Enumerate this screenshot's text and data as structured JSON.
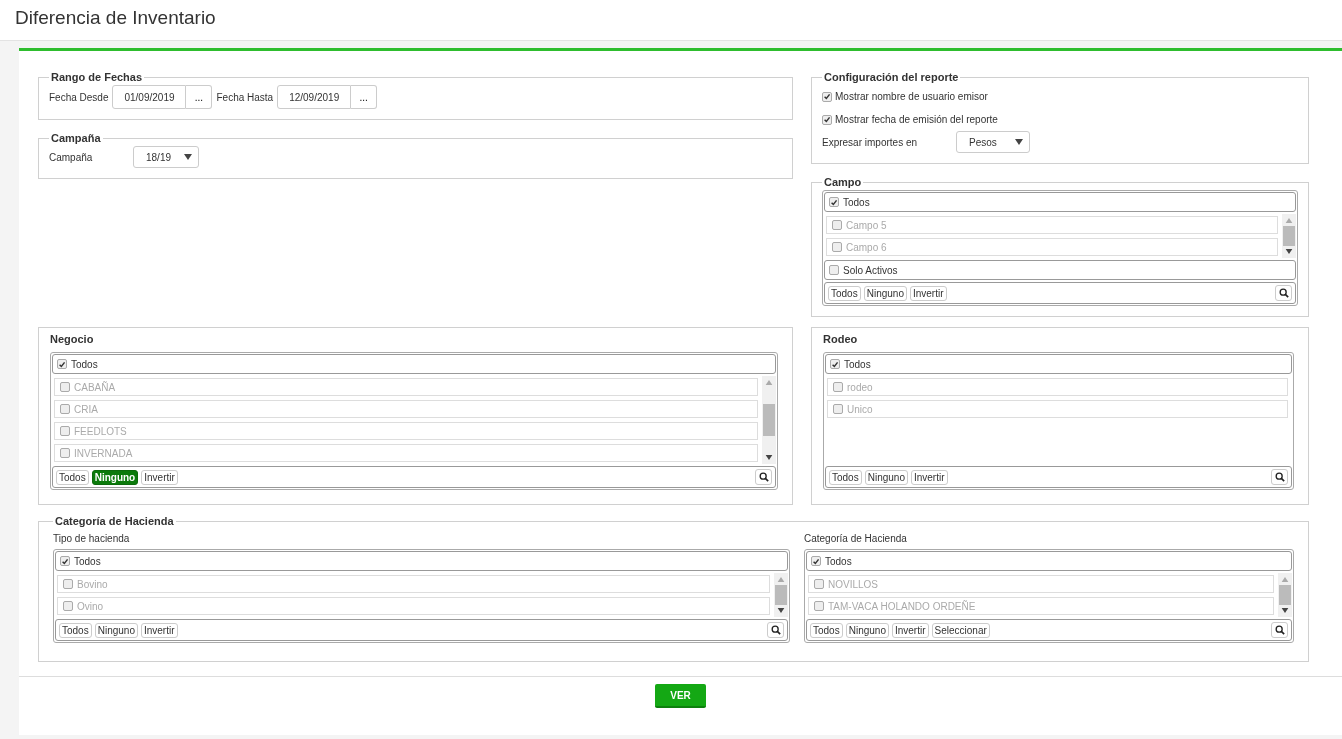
{
  "page": {
    "title": "Diferencia de Inventario"
  },
  "rango_de_fechas": {
    "legend": "Rango de Fechas",
    "fields": [
      {
        "label": "Fecha Desde",
        "value": "01/09/2019",
        "button": "..."
      },
      {
        "label": "Fecha Hasta",
        "value": "12/09/2019",
        "button": "..."
      }
    ]
  },
  "campana": {
    "legend": "Campaña",
    "label": "Campaña",
    "value": "18/19"
  },
  "configuracion": {
    "legend": "Configuración del reporte",
    "options": [
      {
        "label": "Mostrar nombre de usuario emisor",
        "checked": true
      },
      {
        "label": "Mostrar fecha de emisión del reporte",
        "checked": true
      }
    ],
    "importes": {
      "label": "Expresar importes en",
      "value": "Pesos"
    }
  },
  "campo": {
    "kind": "legend",
    "title": "Campo",
    "select": {
      "all": {
        "label": "Todos",
        "checked": true
      },
      "items": [
        {
          "label": "Campo 5",
          "checked": false,
          "disabled": true
        },
        {
          "label": "Campo 6",
          "checked": false,
          "disabled": true
        }
      ],
      "scrollable": true,
      "filter": {
        "label": "Solo Activos",
        "checked": false
      },
      "actions": [
        {
          "label": "Todos",
          "selected": false
        },
        {
          "label": "Ninguno",
          "selected": false
        },
        {
          "label": "Invertir",
          "selected": false
        }
      ],
      "search": true
    }
  },
  "negocio": {
    "kind": "heading",
    "title": "Negocio",
    "select": {
      "all": {
        "label": "Todos",
        "checked": true
      },
      "items": [
        {
          "label": "CABAÑA",
          "checked": false,
          "disabled": true
        },
        {
          "label": "CRIA",
          "checked": false,
          "disabled": true
        },
        {
          "label": "FEEDLOTS",
          "checked": false,
          "disabled": true
        },
        {
          "label": "INVERNADA",
          "checked": false,
          "disabled": true
        }
      ],
      "scrollable": true,
      "actions": [
        {
          "label": "Todos",
          "selected": false
        },
        {
          "label": "Ninguno",
          "selected": true
        },
        {
          "label": "Invertir",
          "selected": false
        }
      ],
      "search": true
    }
  },
  "rodeo": {
    "kind": "heading",
    "title": "Rodeo",
    "select": {
      "all": {
        "label": "Todos",
        "checked": true
      },
      "items": [
        {
          "label": "rodeo",
          "checked": false,
          "disabled": true
        },
        {
          "label": "Unico",
          "checked": false,
          "disabled": true
        }
      ],
      "scrollable": false,
      "actions": [
        {
          "label": "Todos",
          "selected": false
        },
        {
          "label": "Ninguno",
          "selected": false
        },
        {
          "label": "Invertir",
          "selected": false
        }
      ],
      "search": true
    }
  },
  "categoria_de_hacienda": {
    "legend": "Categoría de Hacienda",
    "lists": [
      {
        "label": "Tipo de hacienda",
        "select": {
          "all": {
            "label": "Todos",
            "checked": true
          },
          "items": [
            {
              "label": "Bovino",
              "checked": false,
              "disabled": true
            },
            {
              "label": "Ovino",
              "checked": false,
              "disabled": true
            }
          ],
          "scrollable": true,
          "actions": [
            {
              "label": "Todos",
              "selected": false
            },
            {
              "label": "Ninguno",
              "selected": false
            },
            {
              "label": "Invertir",
              "selected": false
            }
          ],
          "search": true
        }
      },
      {
        "label": "Categoría de Hacienda",
        "select": {
          "all": {
            "label": "Todos",
            "checked": true
          },
          "items": [
            {
              "label": "NOVILLOS",
              "checked": false,
              "disabled": true
            },
            {
              "label": "TAM-VACA HOLANDO ORDEÑE",
              "checked": false,
              "disabled": true
            }
          ],
          "scrollable": true,
          "actions": [
            {
              "label": "Todos",
              "selected": false
            },
            {
              "label": "Ninguno",
              "selected": false
            },
            {
              "label": "Invertir",
              "selected": false
            },
            {
              "label": "Seleccionar",
              "selected": false
            }
          ],
          "search": true
        }
      }
    ]
  },
  "footer": {
    "button": "VER"
  }
}
